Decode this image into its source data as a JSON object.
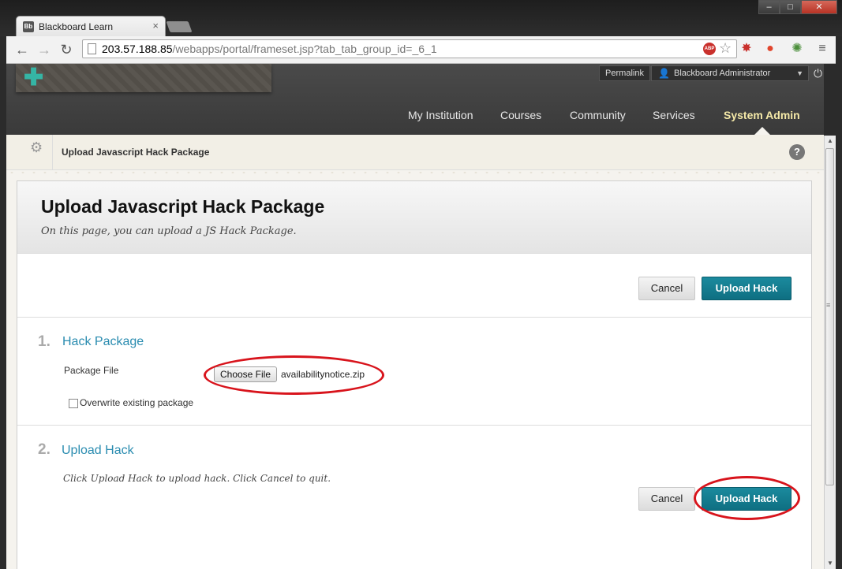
{
  "browser": {
    "tab_title": "Blackboard Learn",
    "tab_favicon": "Bb",
    "url_host": "203.57.188.85",
    "url_path": "/webapps/portal/frameset.jsp?tab_tab_group_id=_6_1",
    "abp_label": "ABP",
    "icons": [
      "back-arrow-icon",
      "forward-arrow-icon",
      "reload-icon",
      "page-icon",
      "adblock-icon",
      "bookmark-star-icon",
      "extension-icon",
      "stumbleupon-icon",
      "color-wheel-icon",
      "menu-icon"
    ]
  },
  "header": {
    "permalink": "Permalink",
    "user_name": "Blackboard Administrator",
    "nav": [
      "My Institution",
      "Courses",
      "Community",
      "Services",
      "System Admin"
    ],
    "active_tab": "System Admin"
  },
  "breadcrumb": {
    "label": "Upload Javascript Hack Package"
  },
  "main": {
    "title": "Upload Javascript Hack Package",
    "description": "On this page, you can upload a JS Hack Package.",
    "cancel_label": "Cancel",
    "submit_label": "Upload Hack",
    "step1": {
      "number": "1.",
      "title": "Hack Package",
      "field_label": "Package File",
      "choose_file_label": "Choose File",
      "file_name": "availabilitynotice.zip",
      "overwrite_label": "Overwrite existing package",
      "overwrite_checked": false
    },
    "step2": {
      "number": "2.",
      "title": "Upload Hack",
      "instructions": "Click Upload Hack to upload hack. Click Cancel to quit."
    }
  },
  "annotation_color": "#d8141c",
  "accent_color": "#0e6f82"
}
